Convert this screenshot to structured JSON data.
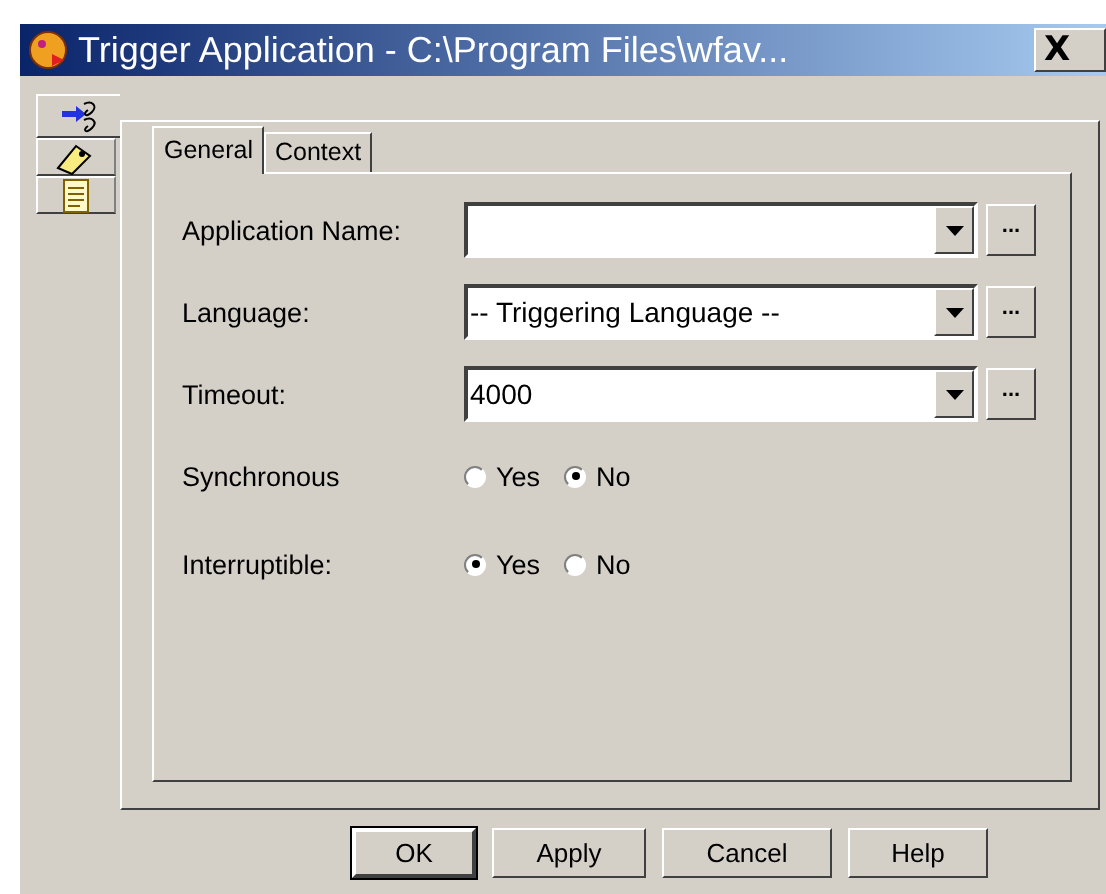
{
  "window": {
    "title": "Trigger Application - C:\\Program Files\\wfav...",
    "close_label": "X"
  },
  "side_tabs": [
    {
      "selected": true
    },
    {
      "selected": false
    },
    {
      "selected": false
    }
  ],
  "tabs": [
    {
      "label": "General",
      "selected": true
    },
    {
      "label": "Context",
      "selected": false
    }
  ],
  "fields": [
    {
      "label": "Application Name:"
    },
    {
      "label": "Language:",
      "value": "-- Triggering Language --"
    },
    {
      "label": "Timeout:",
      "value": "4000"
    }
  ],
  "options": [
    {
      "label": "Synchronous",
      "choices": [
        {
          "label": "Yes",
          "selected": false
        },
        {
          "label": "No",
          "selected": true
        }
      ]
    },
    {
      "label": "Interruptible:",
      "choices": [
        {
          "label": "Yes",
          "selected": true
        },
        {
          "label": "No",
          "selected": false
        }
      ]
    }
  ],
  "browse_label": "...",
  "buttons": [
    "OK",
    "Apply",
    "Cancel",
    "Help"
  ]
}
